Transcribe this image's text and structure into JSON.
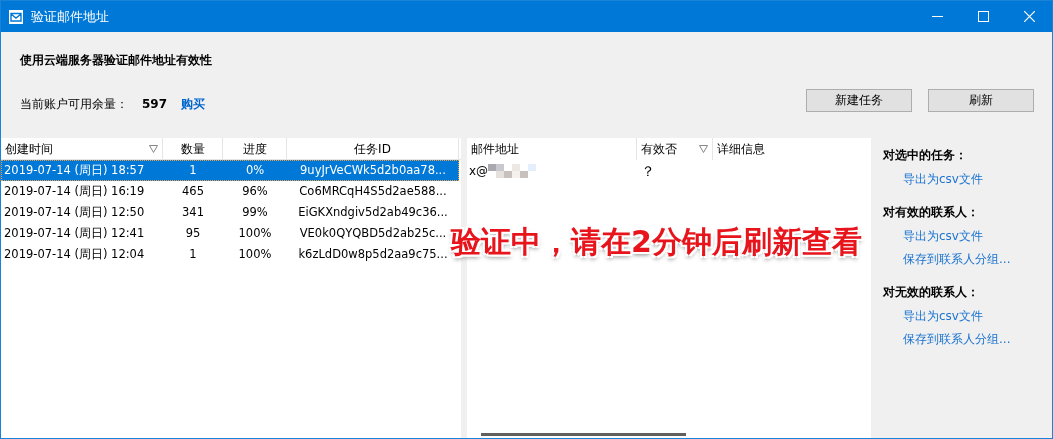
{
  "window": {
    "title": "验证邮件地址"
  },
  "heading": "使用云端服务器验证邮件地址有效性",
  "quota": {
    "label": "当前账户可用余量：",
    "value": "597",
    "buy_link": "购买"
  },
  "buttons": [
    "新建任务",
    "刷新"
  ],
  "tasks": {
    "columns": [
      {
        "label": "创建时间",
        "filter": true
      },
      {
        "label": "数量",
        "filter": false
      },
      {
        "label": "进度",
        "filter": false
      },
      {
        "label": "任务ID",
        "filter": false
      }
    ],
    "rows": [
      {
        "cells": [
          "2019-07-14 (周日) 18:57",
          "1",
          "0%",
          "9uyJrVeCWk5d2b0aa78..."
        ],
        "selected": true
      },
      {
        "cells": [
          "2019-07-14 (周日) 16:19",
          "465",
          "96%",
          "Co6MRCqH4S5d2ae588..."
        ],
        "selected": false
      },
      {
        "cells": [
          "2019-07-14 (周日) 12:50",
          "341",
          "99%",
          "EiGKXndgiv5d2ab49c36..."
        ],
        "selected": false
      },
      {
        "cells": [
          "2019-07-14 (周日) 12:41",
          "95",
          "100%",
          "VE0k0QYQBD5d2ab25c..."
        ],
        "selected": false
      },
      {
        "cells": [
          "2019-07-14 (周日) 12:04",
          "1",
          "100%",
          "k6zLdD0w8p5d2aa9c75..."
        ],
        "selected": false
      }
    ]
  },
  "results": {
    "columns": [
      {
        "label": "邮件地址",
        "filter": false
      },
      {
        "label": "有效否",
        "filter": true
      },
      {
        "label": "详细信息",
        "filter": false
      }
    ],
    "rows": [
      {
        "email": "x@",
        "valid": "？"
      }
    ]
  },
  "overlay_message": "验证中，请在2分钟后刷新查看",
  "actions": [
    {
      "title": "对选中的任务：",
      "links": [
        "导出为csv文件"
      ]
    },
    {
      "title": "对有效的联系人：",
      "links": [
        "导出为csv文件",
        "保存到联系人分组..."
      ]
    },
    {
      "title": "对无效的联系人：",
      "links": [
        "导出为csv文件",
        "保存到联系人分组..."
      ]
    }
  ]
}
